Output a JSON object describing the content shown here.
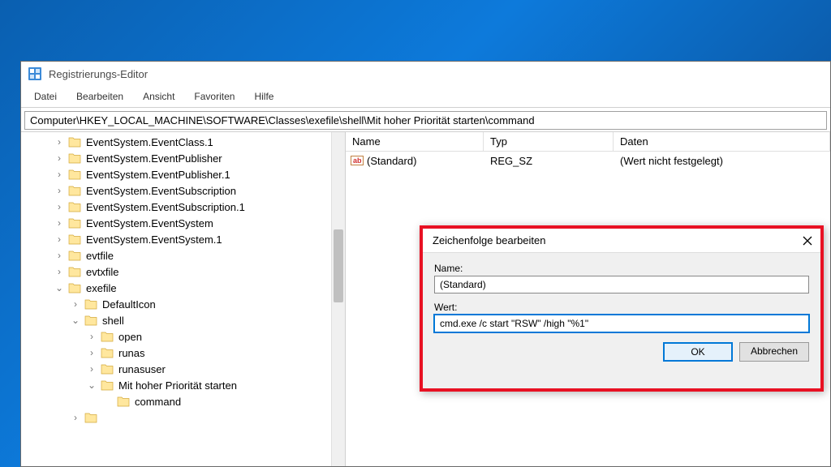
{
  "window": {
    "title": "Registrierungs-Editor"
  },
  "menubar": {
    "file": "Datei",
    "edit": "Bearbeiten",
    "view": "Ansicht",
    "favorites": "Favoriten",
    "help": "Hilfe"
  },
  "address": "Computer\\HKEY_LOCAL_MACHINE\\SOFTWARE\\Classes\\exefile\\shell\\Mit hoher Priorität starten\\command",
  "tree": {
    "items": [
      {
        "indent": 1,
        "toggle": ">",
        "label": "EventSystem.EventClass.1"
      },
      {
        "indent": 1,
        "toggle": ">",
        "label": "EventSystem.EventPublisher"
      },
      {
        "indent": 1,
        "toggle": ">",
        "label": "EventSystem.EventPublisher.1"
      },
      {
        "indent": 1,
        "toggle": ">",
        "label": "EventSystem.EventSubscription"
      },
      {
        "indent": 1,
        "toggle": ">",
        "label": "EventSystem.EventSubscription.1"
      },
      {
        "indent": 1,
        "toggle": ">",
        "label": "EventSystem.EventSystem"
      },
      {
        "indent": 1,
        "toggle": ">",
        "label": "EventSystem.EventSystem.1"
      },
      {
        "indent": 1,
        "toggle": ">",
        "label": "evtfile"
      },
      {
        "indent": 1,
        "toggle": ">",
        "label": "evtxfile"
      },
      {
        "indent": 1,
        "toggle": "v",
        "label": "exefile"
      },
      {
        "indent": 2,
        "toggle": ">",
        "label": "DefaultIcon"
      },
      {
        "indent": 2,
        "toggle": "v",
        "label": "shell"
      },
      {
        "indent": 3,
        "toggle": ">",
        "label": "open"
      },
      {
        "indent": 3,
        "toggle": ">",
        "label": "runas"
      },
      {
        "indent": 3,
        "toggle": ">",
        "label": "runasuser"
      },
      {
        "indent": 3,
        "toggle": "v",
        "label": "Mit hoher Priorität starten"
      },
      {
        "indent": 4,
        "toggle": " ",
        "label": "command"
      },
      {
        "indent": 2,
        "toggle": ">",
        "label": ""
      }
    ]
  },
  "listview": {
    "headers": {
      "name": "Name",
      "type": "Typ",
      "data": "Daten"
    },
    "rows": [
      {
        "name": "(Standard)",
        "type": "REG_SZ",
        "data": "(Wert nicht festgelegt)"
      }
    ]
  },
  "dialog": {
    "title": "Zeichenfolge bearbeiten",
    "name_label": "Name:",
    "name_value": "(Standard)",
    "value_label": "Wert:",
    "value_value": "cmd.exe /c start \"RSW\" /high \"%1\"",
    "ok": "OK",
    "cancel": "Abbrechen"
  }
}
